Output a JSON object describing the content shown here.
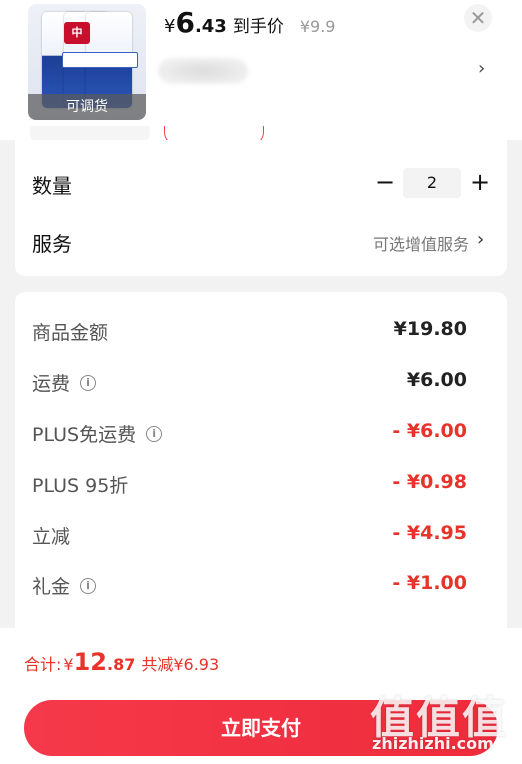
{
  "product": {
    "thumb_overlay": "可调货",
    "price_symbol": "¥",
    "price_int": "6",
    "price_dec": ".43",
    "price_tag": "到手价",
    "original_price": "¥9.9",
    "close_icon": "close-icon",
    "more_icon": "chevron-right-icon"
  },
  "options": {
    "quantity_label": "数量",
    "quantity_value": "2",
    "minus_symbol": "−",
    "plus_symbol": "+",
    "service_label": "服务",
    "service_hint": "可选增值服务",
    "service_chevron": "›"
  },
  "breakdown": {
    "items": [
      {
        "label": "商品金额",
        "value": "¥19.80",
        "info": false,
        "highlight": false
      },
      {
        "label": "运费",
        "value": "¥6.00",
        "info": true,
        "highlight": false
      },
      {
        "label": "PLUS免运费",
        "value": "- ¥6.00",
        "info": true,
        "highlight": true
      },
      {
        "label": "PLUS 95折",
        "value": "- ¥0.98",
        "info": false,
        "highlight": true
      },
      {
        "label": "立减",
        "value": "- ¥4.95",
        "info": false,
        "highlight": true
      },
      {
        "label": "礼金",
        "value": "- ¥1.00",
        "info": true,
        "highlight": true
      }
    ]
  },
  "footer": {
    "total_label": "合计:",
    "total_symbol": "¥",
    "total_int": "12",
    "total_dec": ".87",
    "saved_text": "共减¥6.93",
    "pay_label": "立即支付"
  },
  "watermark": {
    "glyphs": "值值值",
    "domain": "zhizhizhi.com"
  },
  "colors": {
    "accent_red": "#e8332a",
    "pay_button": "#f5394a",
    "background": "#f2f2f2"
  }
}
